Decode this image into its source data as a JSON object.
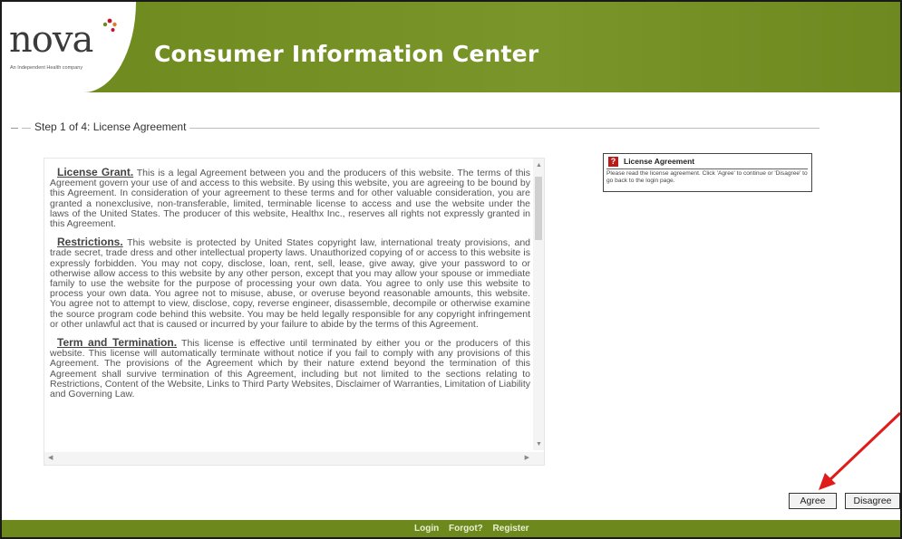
{
  "header": {
    "logo_text": "nova",
    "logo_sub": "An Independent Health company",
    "title": "Consumer Information Center",
    "colors": {
      "header_bg": "#6f8a1f",
      "title": "#ffffff"
    }
  },
  "step": {
    "legend": "Step 1 of 4: License Agreement"
  },
  "license": {
    "sections": [
      {
        "title": "License Grant.",
        "body": "This is a legal Agreement between you and the producers of this website. The terms of this Agreement govern your use of and access to this website. By using this website, you are agreeing to be bound by this Agreement. In consideration of your agreement to these terms and for other valuable consideration, you are granted a nonexclusive, non-transferable, limited, terminable license to access and use the website under the laws of the United States. The producer of this website, Healthx Inc., reserves all rights not expressly granted in this Agreement."
      },
      {
        "title": "Restrictions.",
        "body": "This website is protected by United States copyright law, international treaty provisions, and trade secret, trade dress and other intellectual property laws. Unauthorized copying of or access to this website is expressly forbidden. You may not copy, disclose, loan, rent, sell, lease, give away, give your password to or otherwise allow access to this website by any other person, except that you may allow your spouse or immediate family to use the website for the purpose of processing your own data. You agree to only use this website to process your own data. You agree not to misuse, abuse, or overuse beyond reasonable amounts, this website. You agree not to attempt to view, disclose, copy, reverse engineer, disassemble, decompile or otherwise examine the source program code behind this website. You may be held legally responsible for any copyright infringement or other unlawful act that is caused or incurred by your failure to abide by the terms of this Agreement."
      },
      {
        "title": "Term and Termination.",
        "body": "This license is effective until terminated by either you or the producers of this website. This license will automatically terminate without notice if you fail to comply with any provisions of this Agreement. The provisions of the Agreement which by their nature extend beyond the termination of this Agreement shall survive termination of this Agreement, including but not limited to the sections relating to Restrictions, Content of the Website, Links to Third Party Websites, Disclaimer of Warranties, Limitation of Liability and Governing Law."
      }
    ]
  },
  "help": {
    "icon": "help-question-icon",
    "title": "License Agreement",
    "text": "Please read the license agreement. Click 'Agree' to continue or 'Disagree' to go back to the login page."
  },
  "buttons": {
    "agree": "Agree",
    "disagree": "Disagree"
  },
  "footer": {
    "links": [
      "Login",
      "Forgot?",
      "Register"
    ]
  }
}
